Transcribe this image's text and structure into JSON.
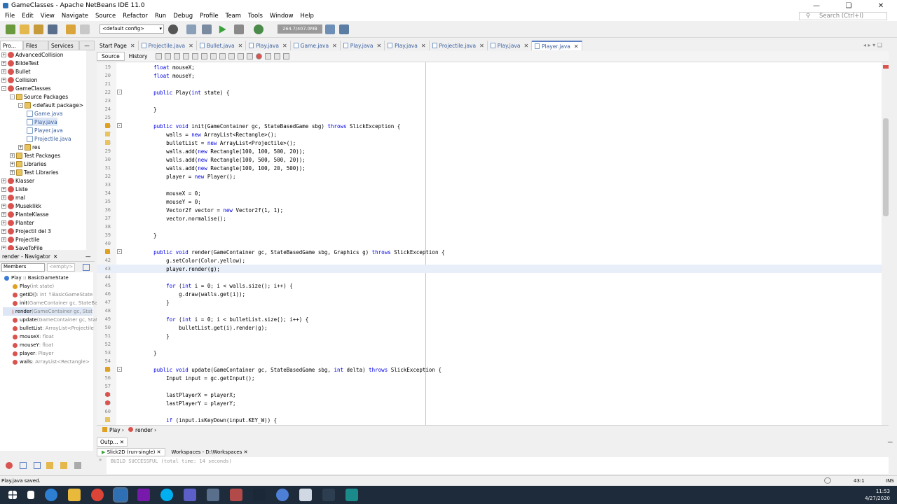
{
  "window": {
    "title": "GameClasses - Apache NetBeans IDE 11.0"
  },
  "menu": [
    "File",
    "Edit",
    "View",
    "Navigate",
    "Source",
    "Refactor",
    "Run",
    "Debug",
    "Profile",
    "Team",
    "Tools",
    "Window",
    "Help"
  ],
  "search": {
    "placeholder": "Search (Ctrl+I)"
  },
  "toolbar": {
    "config": "<default config>",
    "memory": "264.7/407.0MB"
  },
  "project_tabs": [
    "Pro...",
    "Files",
    "Services"
  ],
  "tree": [
    {
      "label": "AdvancedCollision",
      "indent": 0,
      "icon": "proj"
    },
    {
      "label": "BildeTest",
      "indent": 0,
      "icon": "proj"
    },
    {
      "label": "Bullet",
      "indent": 0,
      "icon": "proj"
    },
    {
      "label": "Collision",
      "indent": 0,
      "icon": "proj"
    },
    {
      "label": "GameClasses",
      "indent": 0,
      "icon": "proj",
      "expanded": true
    },
    {
      "label": "Source Packages",
      "indent": 1,
      "icon": "fold",
      "expanded": true
    },
    {
      "label": "<default package>",
      "indent": 2,
      "icon": "fold",
      "expanded": true
    },
    {
      "label": "Game.java",
      "indent": 3,
      "icon": "jav"
    },
    {
      "label": "Play.java",
      "indent": 3,
      "icon": "jav",
      "selected": true
    },
    {
      "label": "Player.java",
      "indent": 3,
      "icon": "jav"
    },
    {
      "label": "Projectile.java",
      "indent": 3,
      "icon": "jav"
    },
    {
      "label": "res",
      "indent": 2,
      "icon": "fold"
    },
    {
      "label": "Test Packages",
      "indent": 1,
      "icon": "fold"
    },
    {
      "label": "Libraries",
      "indent": 1,
      "icon": "fold"
    },
    {
      "label": "Test Libraries",
      "indent": 1,
      "icon": "fold"
    },
    {
      "label": "Klasser",
      "indent": 0,
      "icon": "proj"
    },
    {
      "label": "Liste",
      "indent": 0,
      "icon": "proj"
    },
    {
      "label": "mal",
      "indent": 0,
      "icon": "proj"
    },
    {
      "label": "Museklikk",
      "indent": 0,
      "icon": "proj"
    },
    {
      "label": "PlanteKlasse",
      "indent": 0,
      "icon": "proj"
    },
    {
      "label": "Planter",
      "indent": 0,
      "icon": "proj"
    },
    {
      "label": "Projectil del 3",
      "indent": 0,
      "icon": "proj"
    },
    {
      "label": "Projectile",
      "indent": 0,
      "icon": "proj"
    },
    {
      "label": "SaveToFile",
      "indent": 0,
      "icon": "proj"
    }
  ],
  "navigator": {
    "title": "render - Navigator",
    "filter": "Members",
    "empty": "<empty>",
    "items": [
      {
        "name": "Play :: BasicGameState",
        "type": "",
        "color": "#3a7bd5",
        "root": true
      },
      {
        "name": "Play",
        "type": "(int state)",
        "color": "#e0a020"
      },
      {
        "name": "getID()",
        "type": " : int ↑BasicGameState",
        "color": "#d9534f"
      },
      {
        "name": "init",
        "type": "(GameContainer gc, StateBa",
        "color": "#d9534f"
      },
      {
        "name": "render",
        "type": "(GameContainer gc, Stat",
        "color": "#d9534f",
        "selected": true
      },
      {
        "name": "update",
        "type": "(GameContainer gc, Stat",
        "color": "#d9534f"
      },
      {
        "name": "bulletList",
        "type": " : ArrayList<Projectile",
        "color": "#d9534f"
      },
      {
        "name": "mouseX",
        "type": " : float",
        "color": "#d9534f"
      },
      {
        "name": "mouseY",
        "type": " : float",
        "color": "#d9534f"
      },
      {
        "name": "player",
        "type": " : Player",
        "color": "#d9534f"
      },
      {
        "name": "walls",
        "type": " : ArrayList<Rectangle>",
        "color": "#d9534f"
      }
    ]
  },
  "editor_tabs": [
    "Start Page",
    "Projectile.java",
    "Bullet.java",
    "Play.java",
    "Game.java",
    "Play.java",
    "Play.java",
    "Projectile.java",
    "Play.java",
    "Player.java"
  ],
  "source_tabs": [
    "Source",
    "History"
  ],
  "code": [
    {
      "n": "19",
      "t": "    float mouseX;"
    },
    {
      "n": "20",
      "t": "    float mouseY;"
    },
    {
      "n": "21",
      "t": ""
    },
    {
      "n": "22",
      "t": "    public Play(int state) {"
    },
    {
      "n": "23",
      "t": ""
    },
    {
      "n": "24",
      "t": "    }"
    },
    {
      "n": "25",
      "t": ""
    },
    {
      "n": "26",
      "t": "    public void init(GameContainer gc, StateBasedGame sbg) throws SlickException {"
    },
    {
      "n": "27",
      "t": "        walls = new ArrayList<Rectangle>();"
    },
    {
      "n": "28",
      "t": "        bulletList = new ArrayList<Projectile>();"
    },
    {
      "n": "29",
      "t": "        walls.add(new Rectangle(100, 100, 500, 20));"
    },
    {
      "n": "30",
      "t": "        walls.add(new Rectangle(100, 500, 500, 20));"
    },
    {
      "n": "31",
      "t": "        walls.add(new Rectangle(100, 100, 20, 500));"
    },
    {
      "n": "32",
      "t": "        player = new Player();"
    },
    {
      "n": "33",
      "t": ""
    },
    {
      "n": "34",
      "t": "        mouseX = 0;"
    },
    {
      "n": "35",
      "t": "        mouseY = 0;"
    },
    {
      "n": "36",
      "t": "        Vector2f vector = new Vector2f(1, 1);"
    },
    {
      "n": "37",
      "t": "        vector.normalise();"
    },
    {
      "n": "38",
      "t": ""
    },
    {
      "n": "39",
      "t": "    }"
    },
    {
      "n": "40",
      "t": ""
    },
    {
      "n": "41",
      "t": "    public void render(GameContainer gc, StateBasedGame sbg, Graphics g) throws SlickException {"
    },
    {
      "n": "42",
      "t": "        g.setColor(Color.yellow);"
    },
    {
      "n": "43",
      "t": "        player.render(g);"
    },
    {
      "n": "44",
      "t": ""
    },
    {
      "n": "45",
      "t": "        for (int i = 0; i < walls.size(); i++) {"
    },
    {
      "n": "46",
      "t": "            g.draw(walls.get(i));"
    },
    {
      "n": "47",
      "t": "        }"
    },
    {
      "n": "48",
      "t": ""
    },
    {
      "n": "49",
      "t": "        for (int i = 0; i < bulletList.size(); i++) {"
    },
    {
      "n": "50",
      "t": "            bulletList.get(i).render(g);"
    },
    {
      "n": "51",
      "t": "        }"
    },
    {
      "n": "52",
      "t": ""
    },
    {
      "n": "53",
      "t": "    }"
    },
    {
      "n": "54",
      "t": ""
    },
    {
      "n": "55",
      "t": "    public void update(GameContainer gc, StateBasedGame sbg, int delta) throws SlickException {"
    },
    {
      "n": "56",
      "t": "        Input input = gc.getInput();"
    },
    {
      "n": "57",
      "t": ""
    },
    {
      "n": "58",
      "t": "        lastPlayerX = playerX;"
    },
    {
      "n": "59",
      "t": "        lastPlayerY = playerY;"
    },
    {
      "n": "60",
      "t": ""
    },
    {
      "n": "61",
      "t": "        if (input.isKeyDown(input.KEY_W)) {"
    }
  ],
  "breadcrumbs": [
    "Play",
    "render"
  ],
  "output": {
    "title": "Outp...",
    "tabs": [
      "Slick2D (run-single)",
      "Workspaces - D:\\Workspaces"
    ],
    "text": "BUILD SUCCESSFUL (total time: 14 seconds)"
  },
  "status": {
    "message": "Play.java saved.",
    "position": "43:1",
    "mode": "INS"
  },
  "clock": {
    "time": "11:53",
    "date": "4/27/2020"
  }
}
